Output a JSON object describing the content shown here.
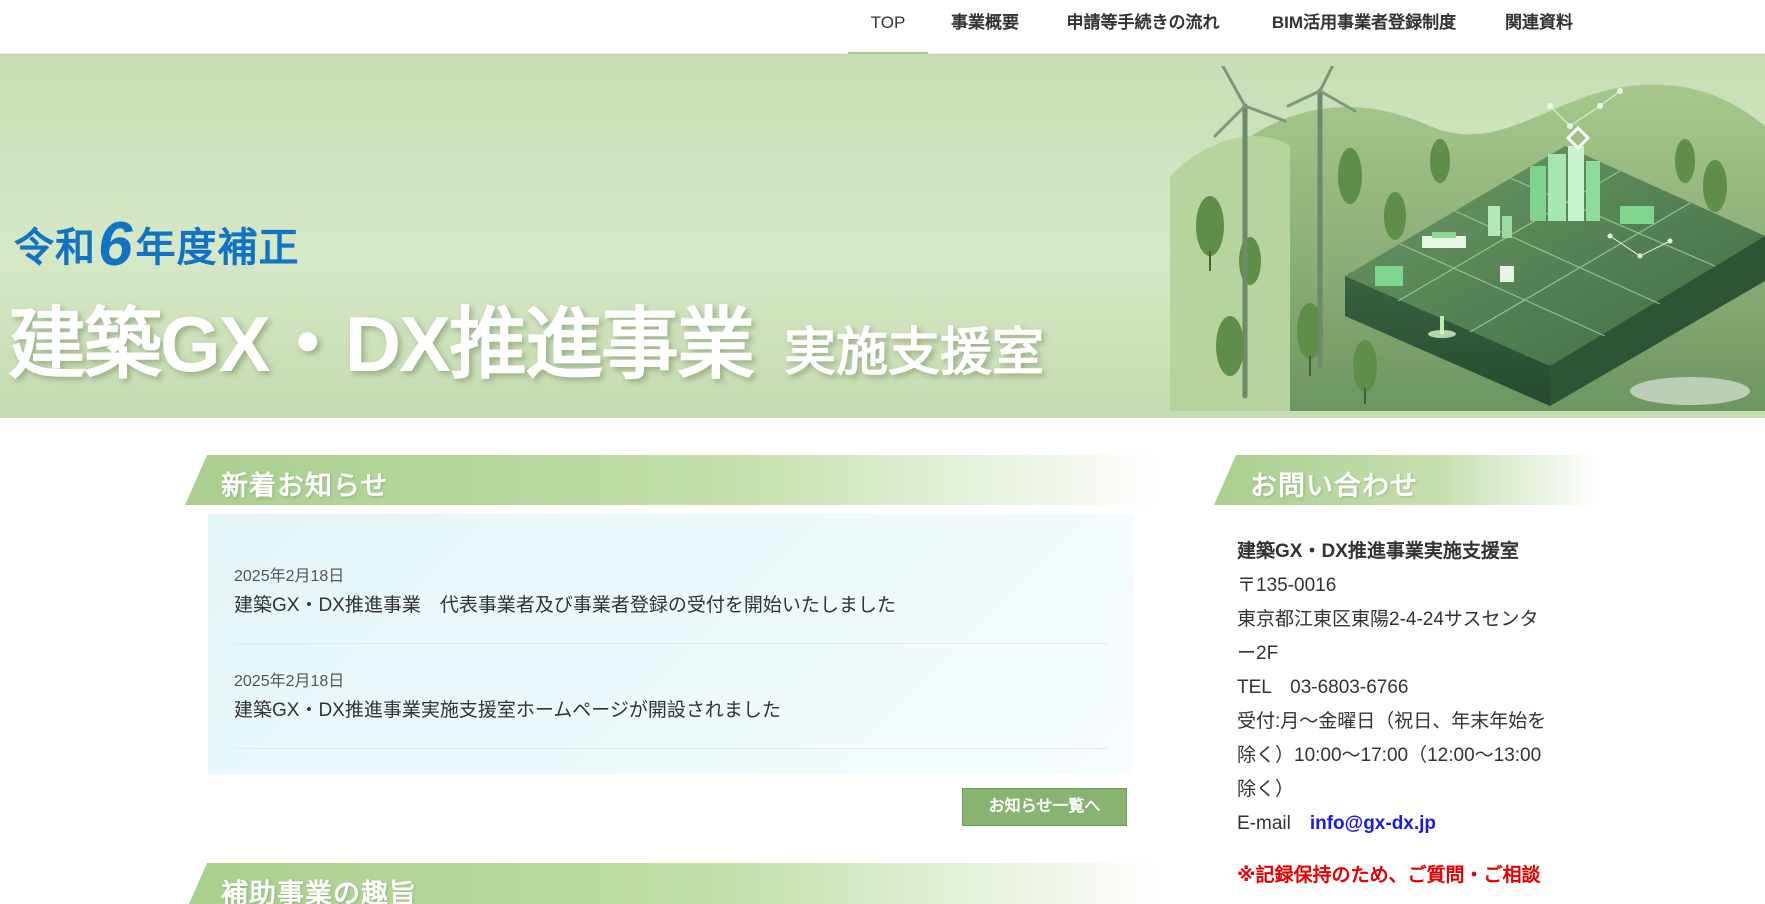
{
  "nav": {
    "items": [
      {
        "label": "TOP"
      },
      {
        "label": "事業概要"
      },
      {
        "label": "申請等手続きの流れ"
      },
      {
        "label": "BIM活用事業者登録制度"
      },
      {
        "label": "関連資料"
      }
    ]
  },
  "hero": {
    "subtitle_pre": "令和",
    "subtitle_num": "6",
    "subtitle_post": "年度補正",
    "title": "建築GX・DX推進事業",
    "title_suffix": "実施支援室",
    "illustration": "green-city-wind-turbine-illustration"
  },
  "news": {
    "heading": "新着お知らせ",
    "items": [
      {
        "date": "2025年2月18日",
        "text": "建築GX・DX推進事業　代表事業者及び事業者登録の受付を開始いたしました"
      },
      {
        "date": "2025年2月18日",
        "text": "建築GX・DX推進事業実施支援室ホームページが開設されました"
      }
    ],
    "more_button": "お知らせ一覧へ"
  },
  "purpose": {
    "heading": "補助事業の趣旨"
  },
  "contact": {
    "heading": "お問い合わせ",
    "org": "建築GX・DX推進事業実施支援室",
    "postal": "〒135-0016",
    "address_line1": "東京都江東区東陽2-4-24サスセンタ",
    "address_line2": "ー2F",
    "tel": "TEL　03-6803-6766",
    "hours_line1": "受付:月～金曜日（祝日、年末年始を",
    "hours_line2": "除く）10:00～17:00（12:00～13:00",
    "hours_line3": "除く）",
    "email_label": "E-mail　",
    "email": "info@gx-dx.jp",
    "note": "※記録保持のため、ご質問・ご相談"
  },
  "colors": {
    "band_green": "#a8cf8e",
    "accent_blue": "#1173c4",
    "button_green": "#88b471",
    "note_red": "#e60000",
    "link_blue": "#1a1ae6"
  }
}
